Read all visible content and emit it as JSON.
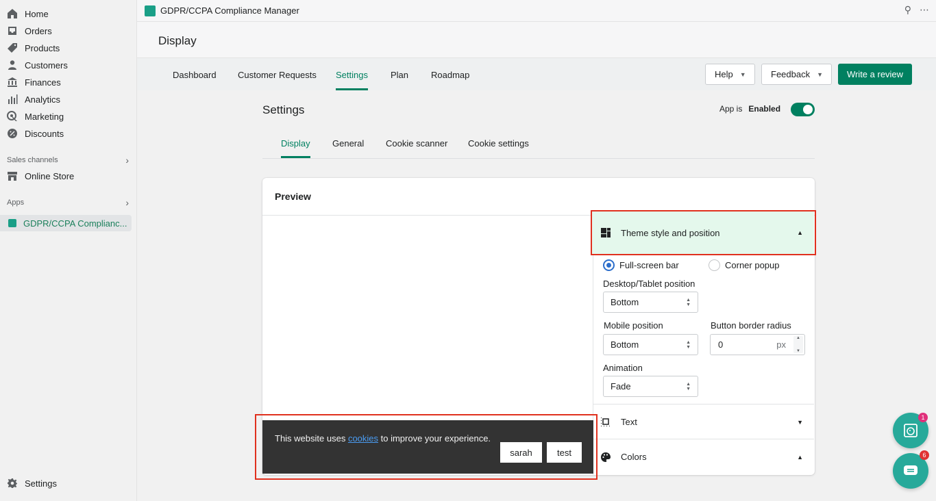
{
  "sidebar": {
    "items": [
      {
        "label": "Home",
        "icon": "home-icon"
      },
      {
        "label": "Orders",
        "icon": "orders-icon"
      },
      {
        "label": "Products",
        "icon": "tag-icon"
      },
      {
        "label": "Customers",
        "icon": "person-icon"
      },
      {
        "label": "Finances",
        "icon": "bank-icon"
      },
      {
        "label": "Analytics",
        "icon": "bar-chart-icon"
      },
      {
        "label": "Marketing",
        "icon": "target-icon"
      },
      {
        "label": "Discounts",
        "icon": "discount-icon"
      }
    ],
    "sales_channels_label": "Sales channels",
    "online_store_label": "Online Store",
    "apps_label": "Apps",
    "active_app_label": "GDPR/CCPA Complianc...",
    "settings_label": "Settings"
  },
  "topbar": {
    "app_title": "GDPR/CCPA Compliance Manager"
  },
  "page": {
    "title": "Display"
  },
  "tabs": [
    {
      "label": "Dashboard",
      "active": false
    },
    {
      "label": "Customer Requests",
      "active": false
    },
    {
      "label": "Settings",
      "active": true
    },
    {
      "label": "Plan",
      "active": false
    },
    {
      "label": "Roadmap",
      "active": false
    }
  ],
  "actions": {
    "help_label": "Help",
    "feedback_label": "Feedback",
    "write_review_label": "Write a review"
  },
  "settings": {
    "title": "Settings",
    "app_is_label": "App is",
    "app_status": "Enabled",
    "subtabs": [
      {
        "label": "Display",
        "active": true
      },
      {
        "label": "General",
        "active": false
      },
      {
        "label": "Cookie scanner",
        "active": false
      },
      {
        "label": "Cookie settings",
        "active": false
      }
    ]
  },
  "preview": {
    "title": "Preview",
    "banner_text_before": "This website uses ",
    "banner_link": "cookies",
    "banner_text_after": " to improve your experience.",
    "accept_label": "sarah",
    "decline_label": "test"
  },
  "theme": {
    "section_title": "Theme style and position",
    "option_fullscreen": "Full-screen bar",
    "option_corner": "Corner popup",
    "selected_option": "Full-screen bar",
    "desktop_position_label": "Desktop/Tablet position",
    "desktop_position_value": "Bottom",
    "mobile_position_label": "Mobile position",
    "mobile_position_value": "Bottom",
    "border_radius_label": "Button border radius",
    "border_radius_value": "0",
    "border_radius_unit": "px",
    "animation_label": "Animation",
    "animation_value": "Fade"
  },
  "sections": {
    "text_label": "Text",
    "colors_label": "Colors"
  },
  "floating": {
    "badge_top": "1",
    "badge_bottom": "6"
  },
  "colors": {
    "accent": "#008060",
    "highlight_bg": "#e4f8ec",
    "annotation_red": "#e0301e",
    "banner_bg": "#333333"
  }
}
